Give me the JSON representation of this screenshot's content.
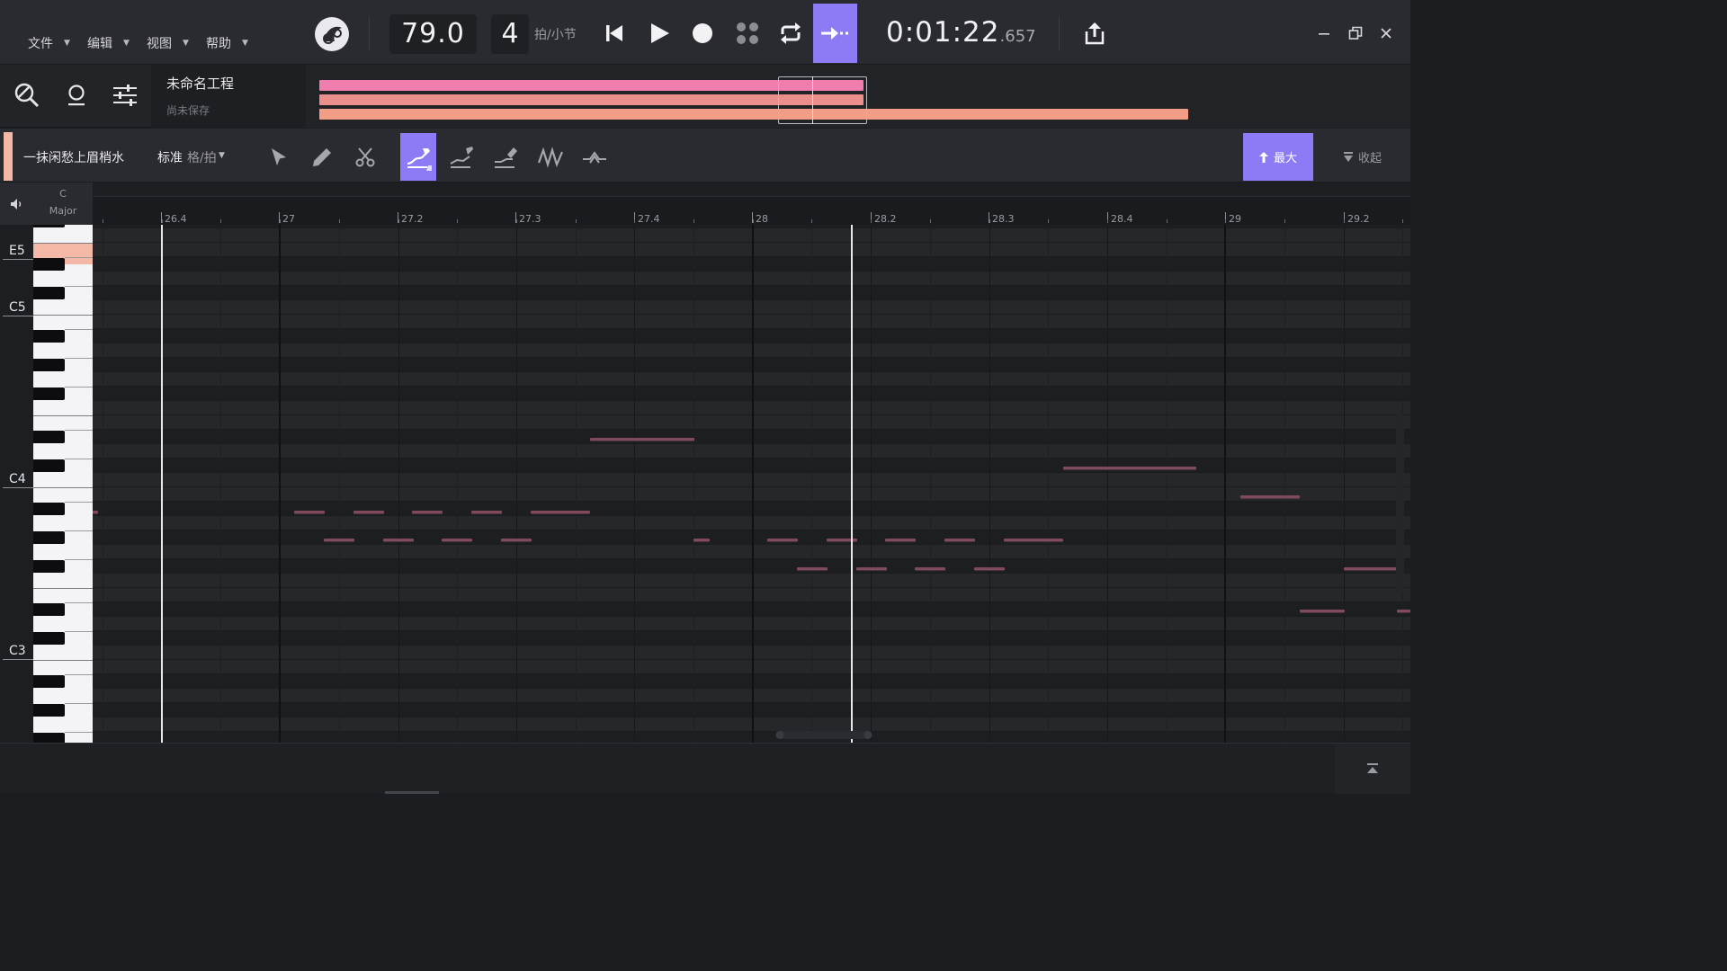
{
  "menu": {
    "file": "文件",
    "edit": "编辑",
    "view": "视图",
    "help": "帮助"
  },
  "transport": {
    "tempo": "79.0",
    "beats": "4",
    "beats_unit": "拍/小节",
    "time_main": "0:01:22",
    "time_ms": ".657"
  },
  "project": {
    "name": "未命名工程",
    "status": "尚未保存"
  },
  "track": {
    "name": "一抹闲愁上眉梢水",
    "quantize_label": "标准",
    "quantize_value": "格/拍",
    "max_label": "最大",
    "collapse_label": "收起",
    "color": "#f4b8a6"
  },
  "key": {
    "root": "C",
    "mode": "Major"
  },
  "keyboard": {
    "labels": [
      "E5",
      "C5",
      "C4",
      "C3"
    ],
    "highlighted_key": "E5"
  },
  "ruler": {
    "labels": [
      "26.4",
      "27",
      "27.2",
      "27.3",
      "27.4",
      "28",
      "28.2",
      "28.3",
      "28.4",
      "29",
      "29.2"
    ]
  },
  "colors": {
    "accent": "#8b7cf6",
    "note": "#7e4a5c",
    "overview_pink": "#ef7eae",
    "overview_salmon": "#f29d86"
  },
  "icons": {
    "logo": "singer-logo-icon",
    "search": "search-icon",
    "mic": "mic-icon",
    "mixer": "mixer-icon",
    "speaker": "speaker-icon"
  }
}
